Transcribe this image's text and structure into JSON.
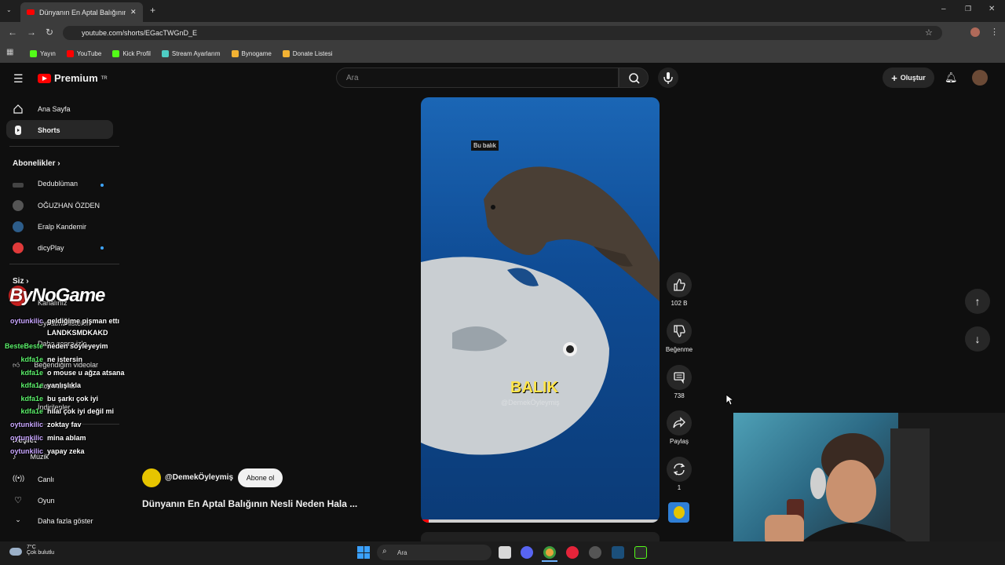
{
  "browser": {
    "tab_title": "Dünyanın En Aptal Balığının",
    "url": "youtube.com/shorts/EGacTWGnD_E",
    "bookmarks": [
      "Yayın",
      "YouTube",
      "Kick Profil",
      "Stream Ayarlarım",
      "Bynogame",
      "Donate Listesi"
    ]
  },
  "header": {
    "logo": "Premium",
    "logo_region": "TR",
    "search_placeholder": "Ara",
    "create_label": "Oluştur"
  },
  "sidebar": {
    "home": "Ana Sayfa",
    "shorts": "Shorts",
    "subscriptions_title": "Abonelikler",
    "subscriptions": [
      {
        "name": "Dedublüman",
        "dot": true
      },
      {
        "name": "OĞUZHAN ÖZDEN",
        "dot": false
      },
      {
        "name": "Eralp Kandemir",
        "dot": false
      },
      {
        "name": "dicyPlay",
        "dot": true
      }
    ],
    "you_title": "Siz",
    "you_items": [
      "Kanalınız",
      "Oynatma listeleri",
      "Daha sonra izle",
      "Beğendiğim videolar",
      "Videolarınız",
      "İndirilenler"
    ],
    "explore_title": "Keşfet",
    "explore_items": [
      "Müzik",
      "Canlı",
      "Oyun",
      "Daha fazla göster"
    ]
  },
  "short": {
    "caption_top": "Bu balık",
    "caption_main": "BALIK",
    "watermark": "@DemekÖyleymiş",
    "channel": "@DemekÖyleymiş",
    "subscribe_label": "Abone ol",
    "title": "Dünyanın En Aptal Balığının Nesli Neden Hala ...",
    "likes": "102 B",
    "dislike_label": "Beğenme",
    "comments": "738",
    "share_label": "Paylaş",
    "remix_count": "1"
  },
  "overlay": {
    "brand": "ByNoGame",
    "chat": [
      {
        "user": "oytunkilic",
        "msg": "geldiğime pişman ettı",
        "color": "#c9a6ff"
      },
      {
        "user": "",
        "msg": "LANDKSMDKAKD",
        "color": "#c9a6ff"
      },
      {
        "user": "BesteBeste",
        "msg": "neden söyleyeyim",
        "color": "#5cf06b"
      },
      {
        "user": "kdfa1e",
        "msg": "ne istersin",
        "color": "#5cf06b"
      },
      {
        "user": "kdfa1e",
        "msg": "o mouse u ağza atsana",
        "color": "#5cf06b"
      },
      {
        "user": "kdfa1e",
        "msg": "yanlışlıkla",
        "color": "#5cf06b"
      },
      {
        "user": "kdfa1e",
        "msg": "bu şarkı çok iyi",
        "color": "#5cf06b"
      },
      {
        "user": "kdfa1e",
        "msg": "hilal çok iyi değil mi",
        "color": "#5cf06b"
      },
      {
        "user": "oytunkilic",
        "msg": "zoktay fav",
        "color": "#c9a6ff"
      },
      {
        "user": "oytunkilic",
        "msg": "mina ablam",
        "color": "#c9a6ff"
      },
      {
        "user": "oytunkilic",
        "msg": "yapay zeka",
        "color": "#c9a6ff"
      }
    ]
  },
  "taskbar": {
    "temp": "7°C",
    "weather": "Çok bulutlu",
    "search": "Ara"
  }
}
